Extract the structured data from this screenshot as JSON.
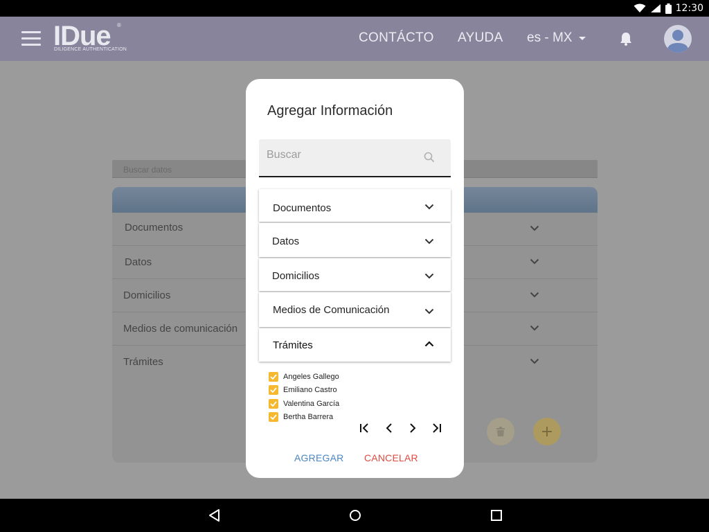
{
  "status_bar": {
    "time": "12:30",
    "icons": [
      "wifi-icon",
      "cellular-signal-icon",
      "battery-icon"
    ]
  },
  "app_bar": {
    "logo": {
      "text": "IDue",
      "tagline": "DILIGENCE AUTHENTICATION",
      "registered_mark": "®"
    },
    "nav": {
      "contact": "CONTÁCTO",
      "help": "AYUDA"
    },
    "language": "es - MX",
    "icons": [
      "menu-icon",
      "bell-icon",
      "avatar-icon"
    ]
  },
  "background": {
    "search_placeholder": "Buscar datos",
    "rows": [
      "Documentos",
      "Datos",
      "Domicilios",
      "Medios de comunicación",
      "Trámites"
    ],
    "actions": [
      "delete-icon",
      "add-icon"
    ]
  },
  "dialog": {
    "title": "Agregar Información",
    "search_placeholder": "Buscar",
    "sections": [
      {
        "label": "Documentos",
        "expanded": false
      },
      {
        "label": "Datos",
        "expanded": false
      },
      {
        "label": "Domicilios",
        "expanded": false
      },
      {
        "label": "Medios de Comunicación",
        "expanded": false
      },
      {
        "label": "Trámites",
        "expanded": true
      }
    ],
    "tramites_items": [
      {
        "label": "Angeles Gallego",
        "checked": true
      },
      {
        "label": "Emiliano Castro",
        "checked": true
      },
      {
        "label": "Valentina García",
        "checked": true
      },
      {
        "label": "Bertha Barrera",
        "checked": true
      }
    ],
    "pager_icons": [
      "first-page-icon",
      "prev-page-icon",
      "next-page-icon",
      "last-page-icon"
    ],
    "buttons": {
      "add": "AGREGAR",
      "cancel": "CANCELAR"
    }
  },
  "colors": {
    "app_bar": "#87849c",
    "checkbox": "#f5b82e",
    "add_button": "#4a86c5",
    "cancel_button": "#e04a3f"
  }
}
